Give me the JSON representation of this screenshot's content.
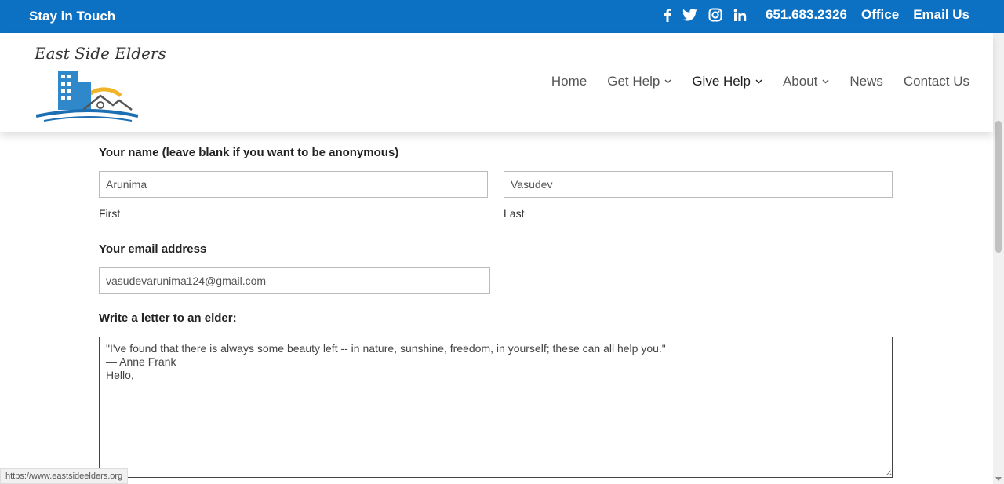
{
  "topbar": {
    "stay_label": "Stay in Touch",
    "social_icons": [
      "facebook-icon",
      "twitter-icon",
      "instagram-icon",
      "linkedin-icon"
    ],
    "phone": "651.683.2326",
    "office_label": "Office",
    "email_label": "Email Us",
    "bg_color": "#0c71c3"
  },
  "logo": {
    "text": "East Side Elders"
  },
  "nav": {
    "items": [
      {
        "label": "Home",
        "has_dropdown": false
      },
      {
        "label": "Get Help",
        "has_dropdown": true
      },
      {
        "label": "Give Help",
        "has_dropdown": true,
        "active": true
      },
      {
        "label": "About",
        "has_dropdown": true
      },
      {
        "label": "News",
        "has_dropdown": false
      },
      {
        "label": "Contact Us",
        "has_dropdown": false
      }
    ]
  },
  "form": {
    "name_label": "Your name (leave blank if you want to be anonymous)",
    "first_value": "Arunima",
    "first_sublabel": "First",
    "last_value": "Vasudev",
    "last_sublabel": "Last",
    "email_label": "Your email address",
    "email_value": "vasudevarunima124@gmail.com",
    "letter_label": "Write a letter to an elder:",
    "letter_value": "\"I've found that there is always some beauty left -- in nature, sunshine, freedom, in yourself; these can all help you.\"\n— Anne Frank\nHello,"
  },
  "status_bar": {
    "url": "https://www.eastsideelders.org"
  }
}
